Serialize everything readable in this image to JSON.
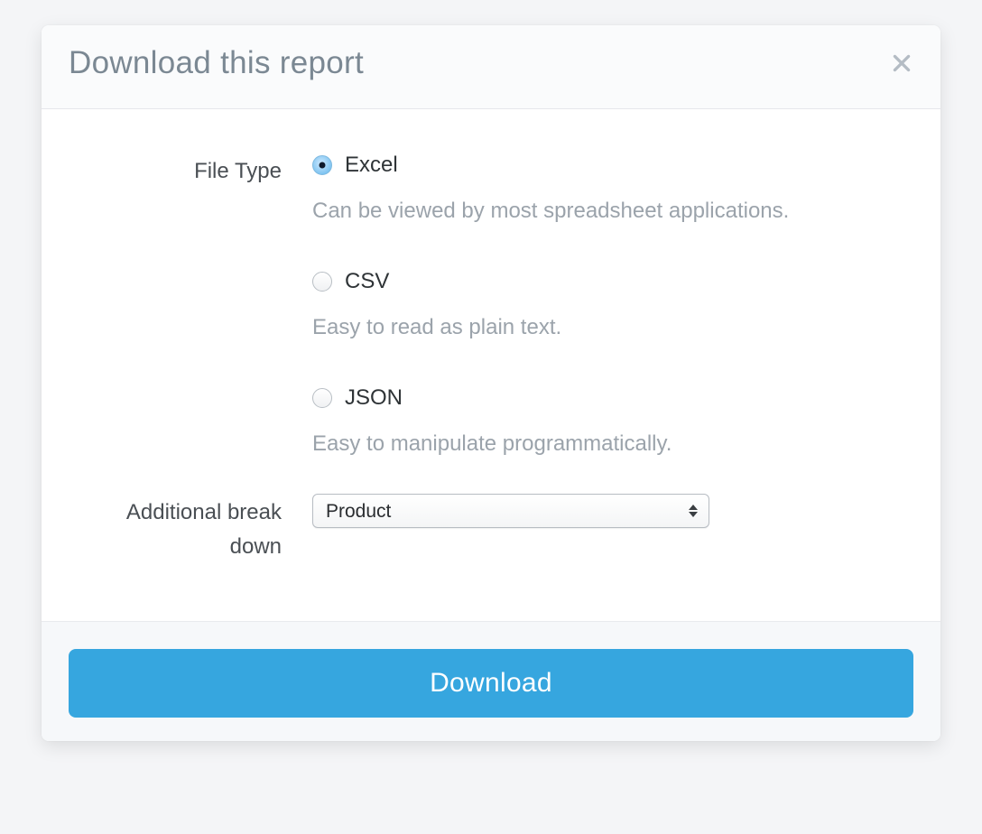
{
  "modal": {
    "title": "Download this report",
    "file_type": {
      "label": "File Type",
      "options": [
        {
          "label": "Excel",
          "desc": "Can be viewed by most spreadsheet applications.",
          "selected": true
        },
        {
          "label": "CSV",
          "desc": "Easy to read as plain text.",
          "selected": false
        },
        {
          "label": "JSON",
          "desc": "Easy to manipulate programmatically.",
          "selected": false
        }
      ]
    },
    "breakdown": {
      "label": "Additional break down",
      "selected": "Product"
    },
    "footer": {
      "download_label": "Download"
    }
  }
}
